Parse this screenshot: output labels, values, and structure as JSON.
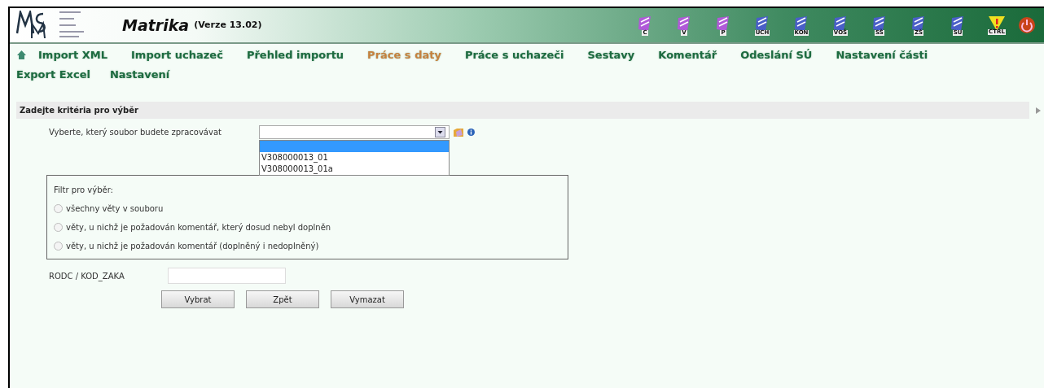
{
  "header": {
    "title": "Matrika",
    "version": "(Verze 13.02)",
    "toolbar": [
      {
        "kind": "doc",
        "label": "C",
        "color": "#b05ad8"
      },
      {
        "kind": "doc",
        "label": "V",
        "color": "#b05ad8"
      },
      {
        "kind": "doc",
        "label": "P",
        "color": "#b05ad8"
      },
      {
        "kind": "doc",
        "label": "UCH",
        "color": "#4a5fc8"
      },
      {
        "kind": "doc",
        "label": "KON",
        "color": "#4a5fc8"
      },
      {
        "kind": "doc",
        "label": "VOŠ",
        "color": "#4a5fc8"
      },
      {
        "kind": "doc",
        "label": "SŠ",
        "color": "#4a5fc8"
      },
      {
        "kind": "doc",
        "label": "ZŠ",
        "color": "#4a5fc8"
      },
      {
        "kind": "doc",
        "label": "SU",
        "color": "#4a5fc8"
      },
      {
        "kind": "warning",
        "label": "CTRL"
      },
      {
        "kind": "power"
      }
    ]
  },
  "menu": {
    "rows": [
      [
        {
          "label": "Import XML",
          "selected": false
        },
        {
          "label": "Import uchazeč",
          "selected": false
        },
        {
          "label": "Přehled importu",
          "selected": false
        },
        {
          "label": "Práce s daty",
          "selected": true
        },
        {
          "label": "Práce s uchazeči",
          "selected": false
        },
        {
          "label": "Sestavy",
          "selected": false
        },
        {
          "label": "Komentář",
          "selected": false
        },
        {
          "label": "Odeslání SÚ",
          "selected": false
        },
        {
          "label": "Nastavení části",
          "selected": false
        }
      ],
      [
        {
          "label": "Export Excel",
          "selected": false
        },
        {
          "label": "Nastavení",
          "selected": false
        }
      ]
    ]
  },
  "section_title": "Zadejte kritéria pro výběr",
  "file_select": {
    "label": "Vyberte, který soubor budete zpracovávat",
    "expanded": true,
    "options": [
      {
        "selected": true
      },
      {
        "label": "V308000013_01",
        "selected": false
      },
      {
        "label": "V308000013_01a",
        "selected": false
      }
    ]
  },
  "filter": {
    "legend": "Filtr pro výběr:",
    "options": [
      {
        "label": "všechny věty v souboru",
        "selected": false
      },
      {
        "label": "věty, u nichž je požadován komentář, který dosud nebyl doplněn",
        "selected": false
      },
      {
        "label": "věty, u nichž je požadován komentář (doplněný i nedoplněný)",
        "selected": false
      }
    ]
  },
  "code_field": {
    "label": "RODC / KOD_ZAKA"
  },
  "buttons": [
    "Vybrat",
    "Zpět",
    "Vymazat"
  ]
}
